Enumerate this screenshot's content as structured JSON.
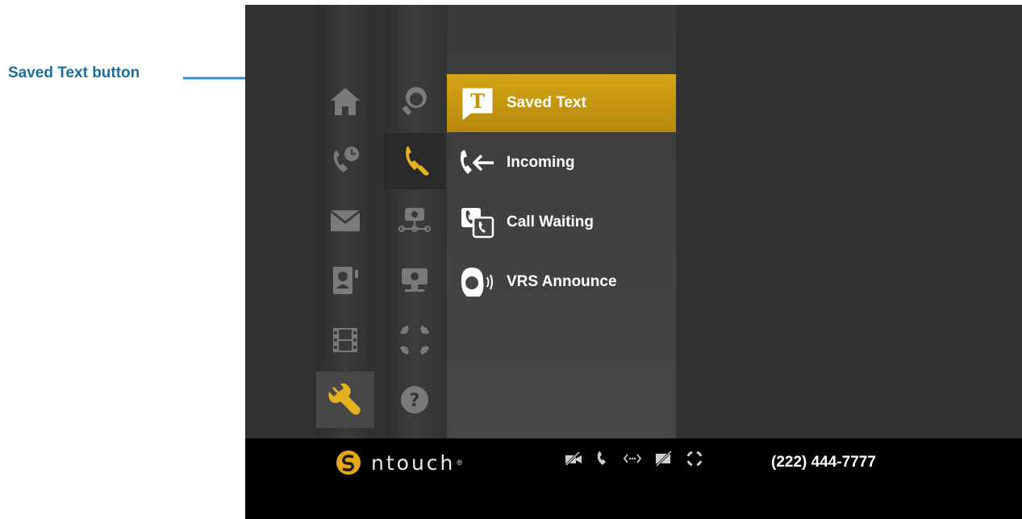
{
  "callout": {
    "label": "Saved Text button"
  },
  "sidebar_main": {
    "items": [
      {
        "icon": "home-icon"
      },
      {
        "icon": "call-history-icon"
      },
      {
        "icon": "mail-icon"
      },
      {
        "icon": "contacts-icon"
      },
      {
        "icon": "video-film-icon"
      },
      {
        "icon": "wrench-settings-icon",
        "selected": true
      }
    ]
  },
  "sidebar_settings": {
    "items": [
      {
        "icon": "personal-settings-icon"
      },
      {
        "icon": "call-settings-icon",
        "selected": true
      },
      {
        "icon": "network-icon"
      },
      {
        "icon": "video-camera-icon"
      },
      {
        "icon": "ring-flasher-icon"
      },
      {
        "icon": "help-icon"
      }
    ]
  },
  "menu": {
    "items": [
      {
        "label": "Saved Text",
        "icon": "saved-text-icon",
        "active": true
      },
      {
        "label": "Incoming",
        "icon": "incoming-call-icon"
      },
      {
        "label": "Call Waiting",
        "icon": "call-waiting-icon"
      },
      {
        "label": "VRS Announce",
        "icon": "vrs-announce-icon"
      }
    ]
  },
  "footer": {
    "brand": "ntouch",
    "registered": "®",
    "phone": "(222) 444-7777",
    "status_icons": [
      "video-off-icon",
      "phone-icon",
      "connection-icon",
      "privacy-off-icon",
      "ring-icon"
    ]
  },
  "colors": {
    "accent": "#d4a516",
    "callout": "#1b6f99",
    "background": "#323232"
  }
}
